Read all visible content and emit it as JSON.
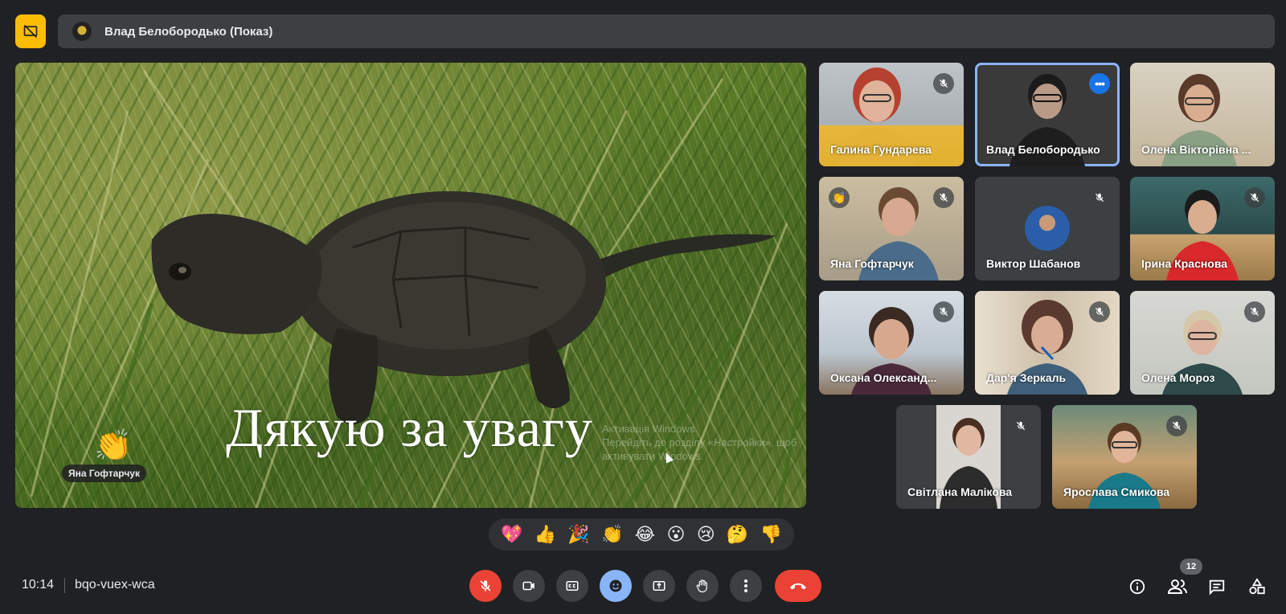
{
  "topbar": {
    "presenter_title": "Влад Белобородько (Показ)"
  },
  "stage": {
    "slide_text": "Дякую за увагу",
    "watermark_line1": "Активація Windows",
    "watermark_line2": "Перейдіть до розділу «Настройки», щоб",
    "watermark_line3": "активувати Windows.",
    "raised_hand_name": "Яна Гофтарчук",
    "raised_hand_emoji": "👏"
  },
  "participants": [
    {
      "name": "Галина Гундарева",
      "muted": true
    },
    {
      "name": "Влад Белобородько",
      "muted": false,
      "active": true
    },
    {
      "name": "Олена Вікторівна ...",
      "muted": false
    },
    {
      "name": "Яна Гофтарчук",
      "muted": true,
      "hand": "👏"
    },
    {
      "name": "Виктор Шабанов",
      "muted": true
    },
    {
      "name": "Ірина Краснова",
      "muted": true
    },
    {
      "name": "Оксана Олександ...",
      "muted": true
    },
    {
      "name": "Дар'я Зеркаль",
      "muted": true
    },
    {
      "name": "Олена Мороз",
      "muted": true
    },
    {
      "name": "Світлана Малікова",
      "muted": true
    },
    {
      "name": "Ярослава Смикова",
      "muted": true
    }
  ],
  "reactions": [
    "💖",
    "👍",
    "🎉",
    "👏",
    "😂",
    "😮",
    "😢",
    "🤔",
    "👎"
  ],
  "bottom": {
    "time": "10:14",
    "meeting_code": "bqo-vuex-wca",
    "participant_count": "12"
  },
  "colors": {
    "background": "#202124",
    "surface": "#3c4043",
    "accent_yellow": "#fbbc04",
    "danger_red": "#ea4335",
    "accent_blue": "#8ab4f8"
  }
}
